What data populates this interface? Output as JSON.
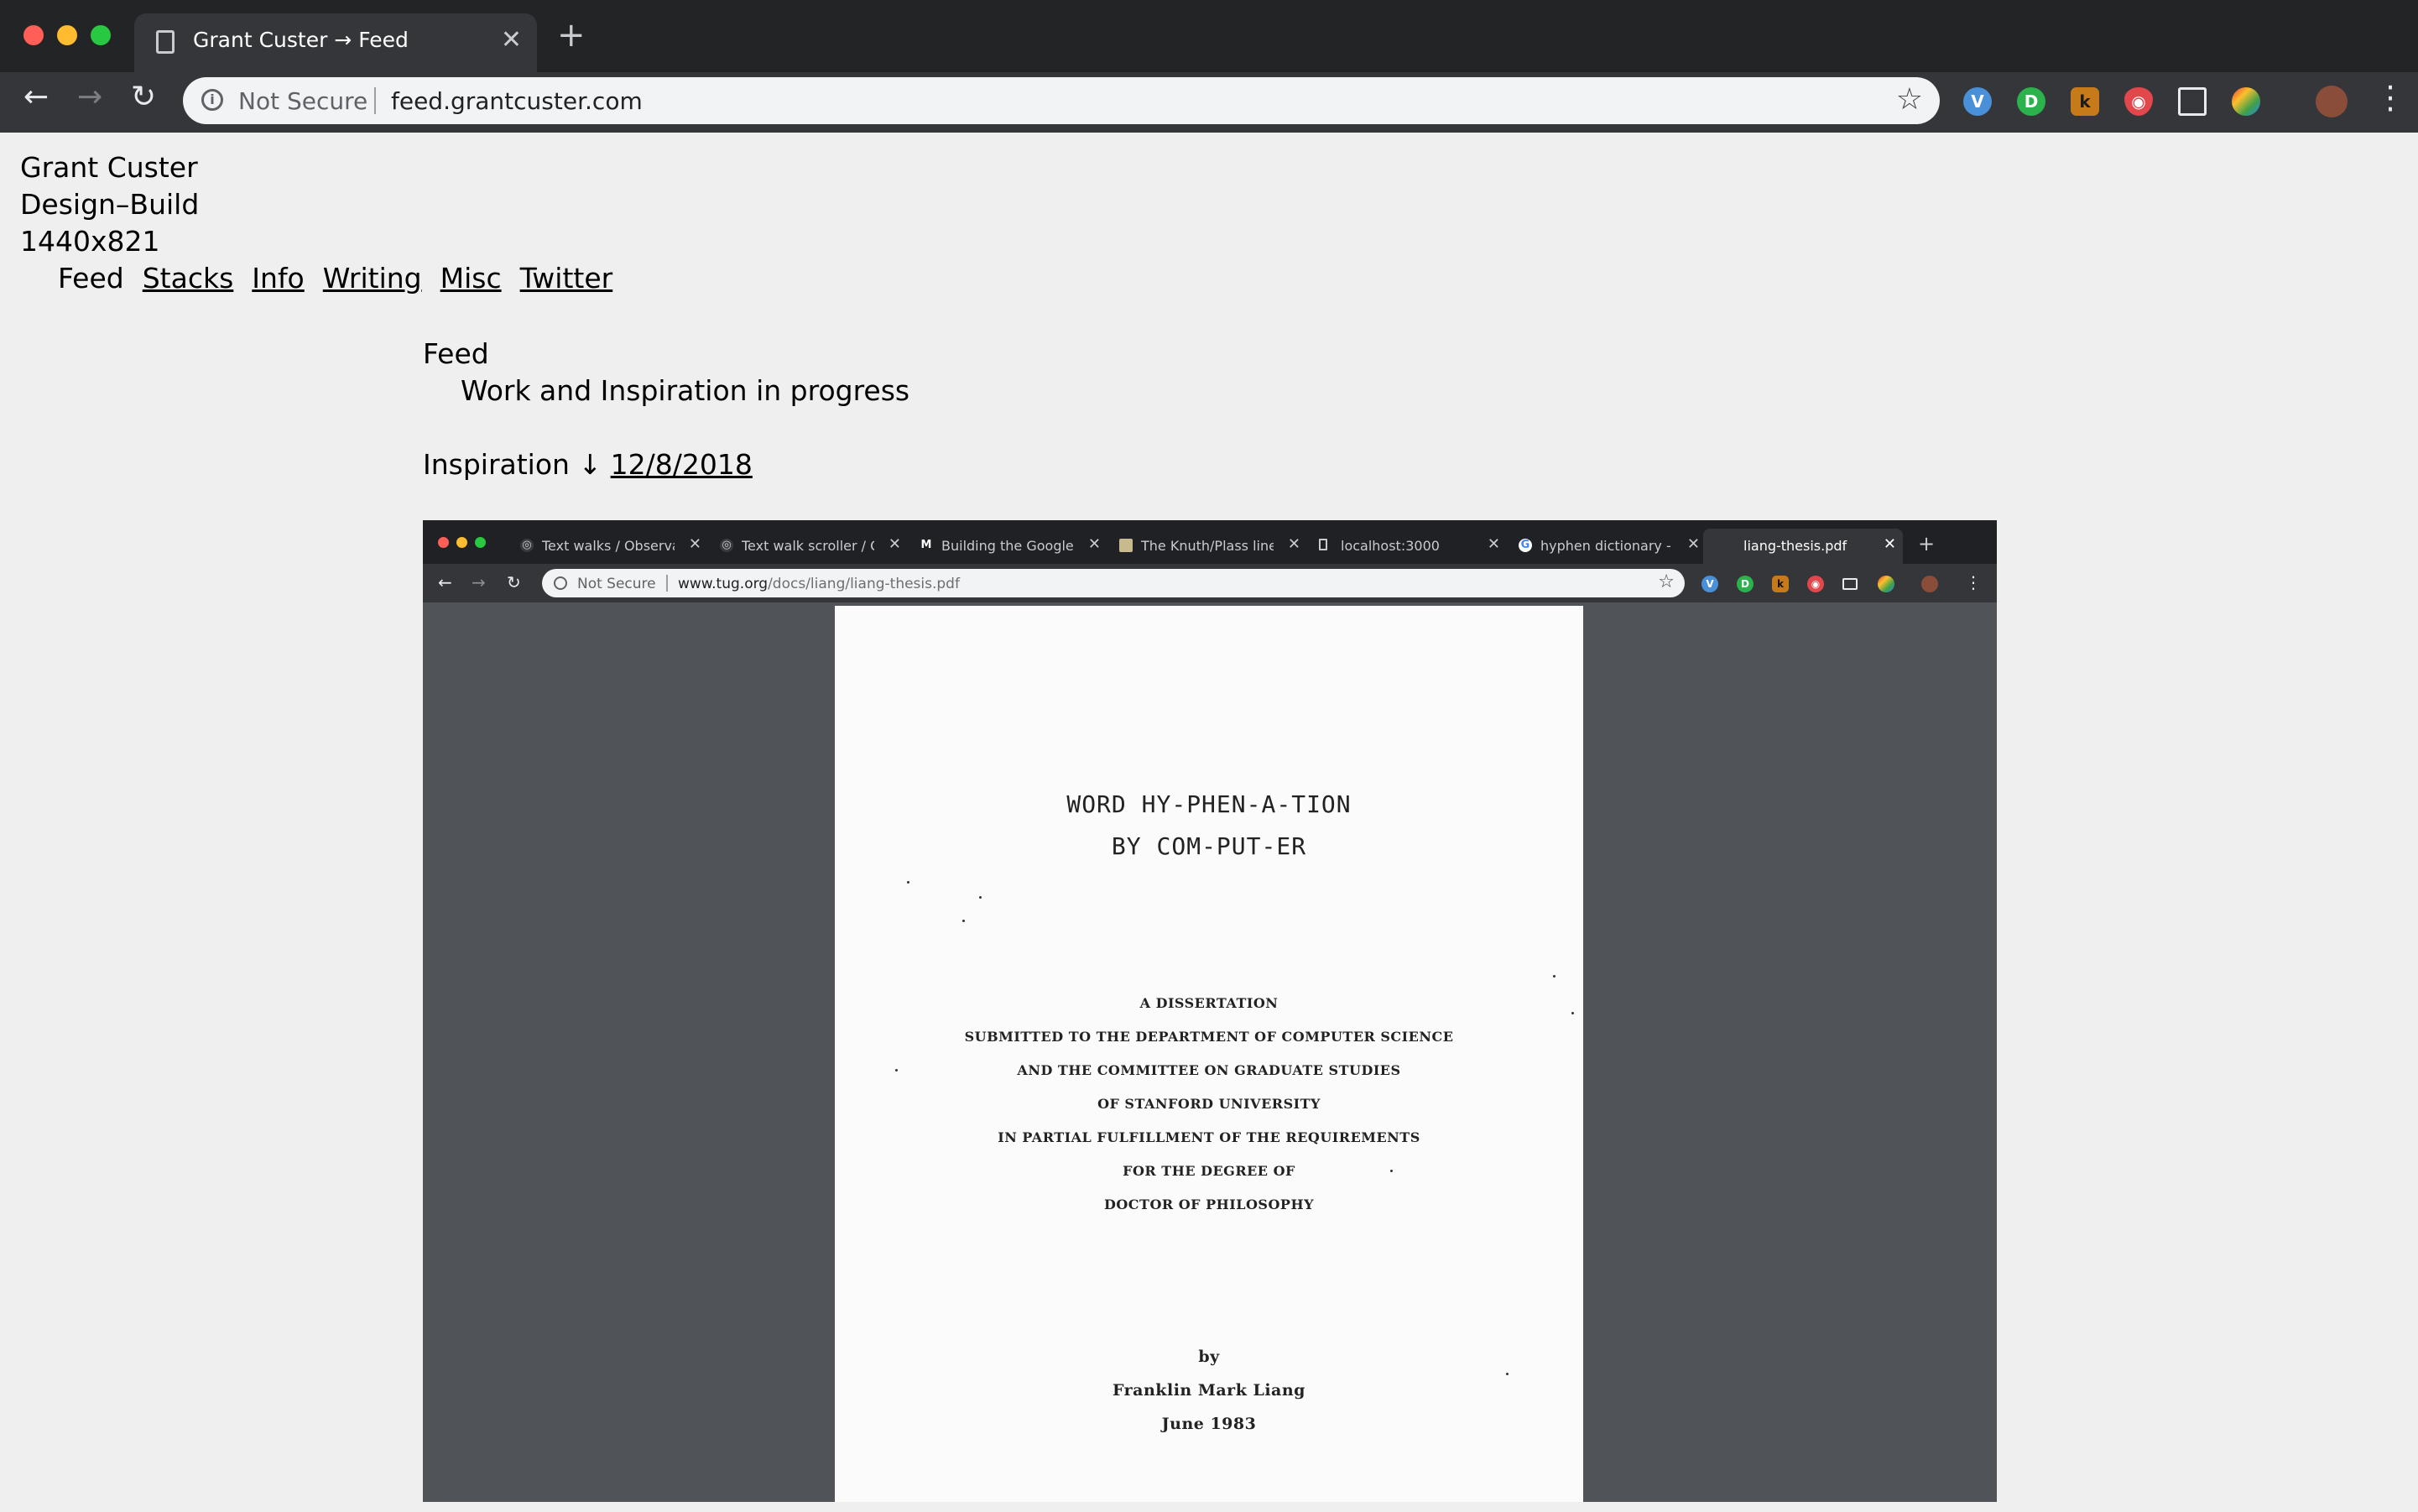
{
  "browser": {
    "tab_title": "Grant Custer → Feed",
    "security_label": "Not Secure",
    "url": "feed.grantcuster.com"
  },
  "site": {
    "name": "Grant Custer",
    "tagline": "Design–Build",
    "viewport": "1440x821",
    "nav": [
      {
        "label": "Feed",
        "link": false
      },
      {
        "label": "Stacks",
        "link": true
      },
      {
        "label": "Info",
        "link": true
      },
      {
        "label": "Writing",
        "link": true
      },
      {
        "label": "Misc",
        "link": true
      },
      {
        "label": "Twitter",
        "link": true
      }
    ]
  },
  "feed": {
    "title": "Feed",
    "subtitle": "Work and Inspiration in progress",
    "entry_label": "Inspiration",
    "arrow": "↓",
    "entry_date": "12/8/2018"
  },
  "screenshot": {
    "tabs": [
      {
        "title": "Text walks / Observable"
      },
      {
        "title": "Text walk scroller / Observable"
      },
      {
        "title": "Building the Google Photos Web UI"
      },
      {
        "title": "The Knuth/Plass line breaking"
      },
      {
        "title": "localhost:3000"
      },
      {
        "title": "hyphen dictionary - Google Search"
      },
      {
        "title": "liang-thesis.pdf"
      }
    ],
    "security_label": "Not Secure",
    "url_domain": "www.tug.org",
    "url_path": "/docs/liang/liang-thesis.pdf",
    "pdf": {
      "title_line1": "WORD HY-PHEN-A-TION",
      "title_line2": "BY COM-PUT-ER",
      "body_lines": [
        "A DISSERTATION",
        "SUBMITTED TO THE DEPARTMENT OF COMPUTER SCIENCE",
        "AND THE COMMITTEE ON GRADUATE STUDIES",
        "OF STANFORD UNIVERSITY",
        "IN PARTIAL FULFILLMENT OF THE REQUIREMENTS",
        "FOR THE DEGREE OF",
        "DOCTOR OF PHILOSOPHY"
      ],
      "by": "by",
      "author": "Franklin Mark Liang",
      "date": "June 1983"
    }
  }
}
